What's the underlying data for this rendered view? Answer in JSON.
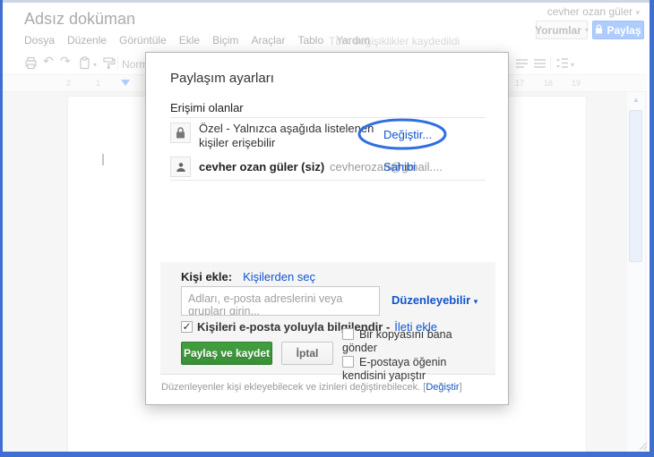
{
  "header": {
    "doc_title": "Adsız doküman",
    "user_name": "cevher ozan güler",
    "comments_button": "Yorumlar",
    "share_button": "Paylaş",
    "menu": [
      "Dosya",
      "Düzenle",
      "Görüntüle",
      "Ekle",
      "Biçim",
      "Araçlar",
      "Tablo",
      "Yardım"
    ],
    "save_status": "Tüm değişiklikler kaydedildi"
  },
  "toolbar": {
    "style_dropdown": "Normal metin"
  },
  "ruler": {
    "left_numbers": [
      "2",
      "1"
    ],
    "right_numbers": [
      "17",
      "18",
      "19"
    ]
  },
  "dialog": {
    "title": "Paylaşım ayarları",
    "access_heading": "Erişimi olanlar",
    "rows": [
      {
        "icon": "lock",
        "text": "Özel - Yalnızca aşağıda listelenen kişiler erişebilir",
        "action": "Değiştir..."
      },
      {
        "icon": "person",
        "name": "cevher ozan güler (siz)",
        "email": "cevherozan@gmail....",
        "action": "Sahibi"
      }
    ],
    "add_people": {
      "label": "Kişi ekle:",
      "choose_link": "Kişilerden seç",
      "placeholder": "Adları, e-posta adreslerini veya grupları girin...",
      "permission": "Düzenleyebilir",
      "notify_label": "Kişileri e-posta yoluyla bilgilendir -",
      "add_message_link": "İleti ekle",
      "share_save_button": "Paylaş ve kaydet",
      "cancel_button": "İptal",
      "copy_checkbox_label": "Bir kopyasını bana gönder",
      "paste_checkbox_label": "E-postaya öğenin kendisini yapıştır"
    },
    "footer": {
      "prefix": "Düzenleyenler kişi ekleyebilecek ve izinleri değiştirebilecek.  [",
      "link": "Değiştir",
      "suffix": "]"
    }
  },
  "icons": {
    "star": "☆",
    "caret_down": "▾",
    "check": "✓",
    "scroll_up": "▲",
    "undo": "↶",
    "redo": "↷"
  },
  "colors": {
    "link_blue": "#1155cc",
    "accent_blue": "#4d90fe",
    "annotation_blue": "#2f6fe0",
    "button_green": "#3a8f37",
    "frame_blue": "#3f6fd1"
  }
}
